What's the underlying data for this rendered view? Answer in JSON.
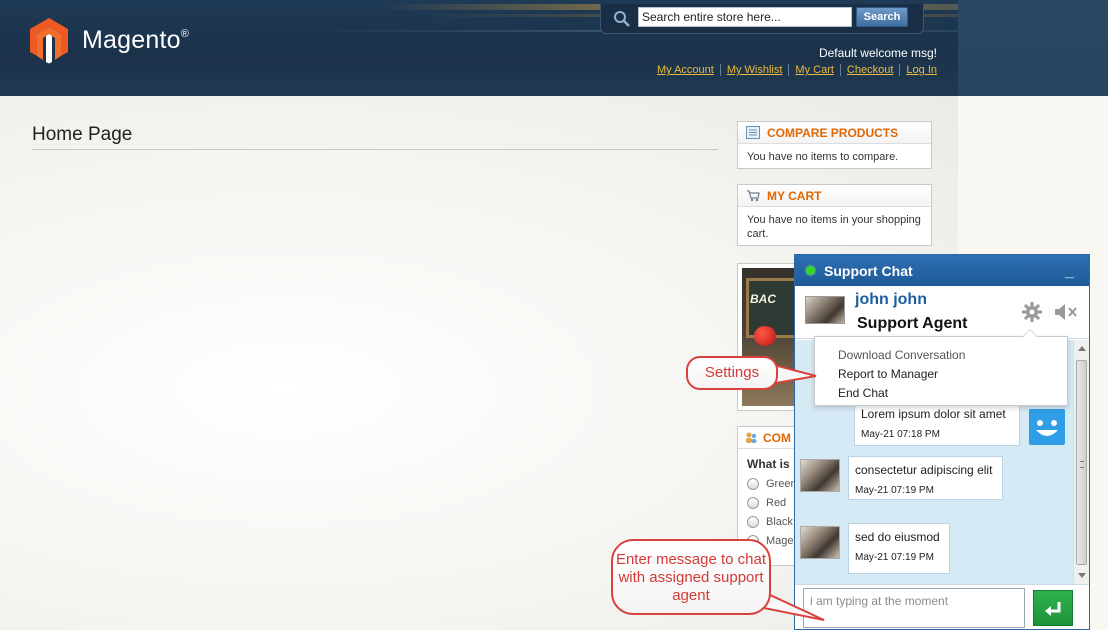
{
  "header": {
    "logo_text": "Magento",
    "logo_reg": "®",
    "search": {
      "placeholder": "Search entire store here...",
      "button": "Search"
    },
    "welcome": "Default welcome msg!",
    "links": [
      "My Account",
      "My Wishlist",
      "My Cart",
      "Checkout",
      "Log In"
    ]
  },
  "main": {
    "page_title": "Home Page"
  },
  "sidebar": {
    "compare": {
      "title": "COMPARE PRODUCTS",
      "body": "You have no items to compare."
    },
    "cart": {
      "title": "MY CART",
      "body": "You have no items in your shopping cart."
    },
    "promo": {
      "text": "BAC"
    },
    "poll": {
      "title": "COM",
      "question": "What is",
      "options": [
        "Green",
        "Red",
        "Black",
        "Mage"
      ]
    }
  },
  "chat": {
    "title": "Support Chat",
    "minimize": "_",
    "agent": {
      "name": "john john",
      "role": "Support Agent"
    },
    "messages": [
      {
        "from": "user",
        "text": "Lorem ipsum dolor sit amet",
        "time": "May-21 07:18 PM"
      },
      {
        "from": "agent",
        "text": "consectetur adipiscing elit",
        "time": "May-21 07:19 PM"
      },
      {
        "from": "agent",
        "text": "sed do eiusmod",
        "time": "May-21 07:19 PM"
      }
    ],
    "input_placeholder": "i am typing at the moment",
    "settings_menu": [
      "Download Conversation",
      "Report to Manager",
      "End Chat"
    ],
    "colors": {
      "header": "#1e5a98",
      "messages_bg": "#d6eaf6",
      "status": "#35d42a",
      "send": "#1d9339"
    }
  },
  "callouts": {
    "settings": "Settings",
    "enter_message": "Enter message to chat with assigned support agent"
  }
}
